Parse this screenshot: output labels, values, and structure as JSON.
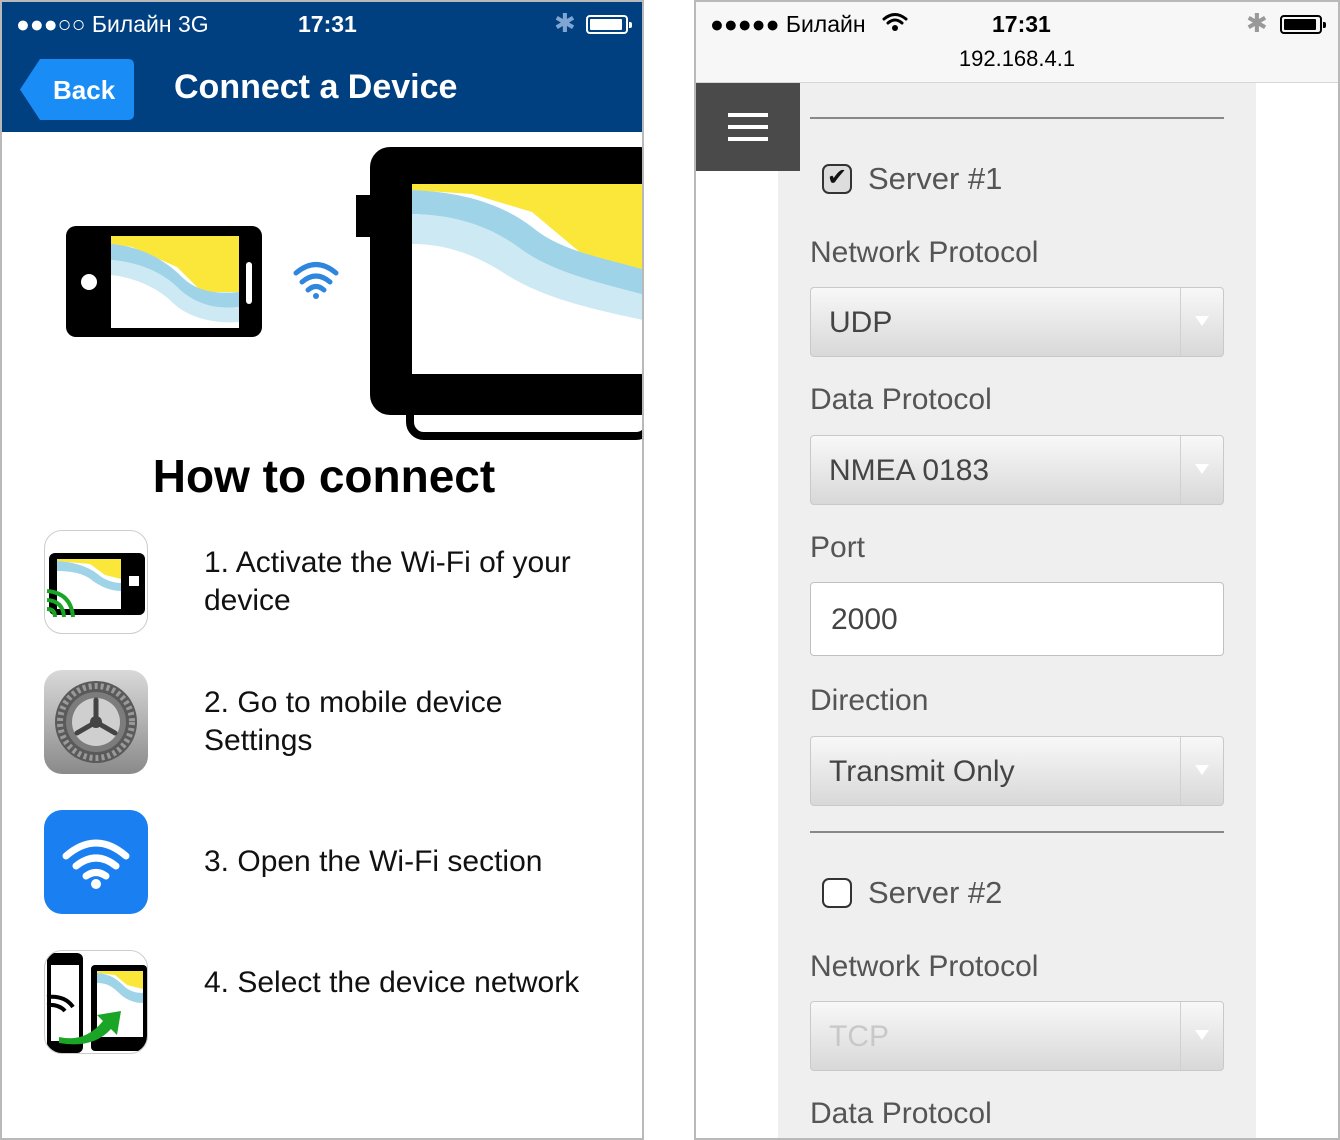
{
  "left": {
    "status": {
      "carrier": "●●●○○ Билайн  3G",
      "time": "17:31"
    },
    "nav": {
      "back": "Back",
      "title": "Connect a Device"
    },
    "heading": "How to connect",
    "steps": [
      {
        "text": "1. Activate the Wi-Fi of your device",
        "icon": "chartplotter-wifi-icon"
      },
      {
        "text": "2. Go to mobile device Settings",
        "icon": "settings-gear-icon"
      },
      {
        "text": "3. Open the Wi-Fi section",
        "icon": "wifi-icon"
      },
      {
        "text": "4. Select the device network",
        "icon": "select-network-icon"
      }
    ]
  },
  "right": {
    "status": {
      "carrier": "●●●●● Билайн",
      "time": "17:31",
      "url": "192.168.4.1"
    },
    "server1": {
      "label": "Server #1",
      "checked": true,
      "network_protocol_label": "Network Protocol",
      "network_protocol": "UDP",
      "data_protocol_label": "Data Protocol",
      "data_protocol": "NMEA 0183",
      "port_label": "Port",
      "port": "2000",
      "direction_label": "Direction",
      "direction": "Transmit Only"
    },
    "server2": {
      "label": "Server #2",
      "checked": false,
      "network_protocol_label": "Network Protocol",
      "network_protocol": "TCP",
      "data_protocol_label": "Data Protocol"
    }
  },
  "colors": {
    "nav_blue": "#003f80",
    "back_blue": "#1a8cf5",
    "wifi_blue": "#2e86de",
    "chart_yellow": "#fbe73a",
    "chart_blue": "#9fd3e8"
  }
}
